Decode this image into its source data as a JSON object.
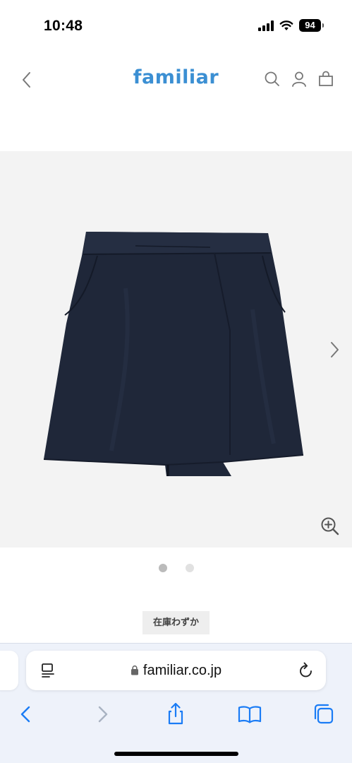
{
  "status_bar": {
    "time": "10:48",
    "battery": "94",
    "icons": [
      "signal-icon",
      "wifi-icon",
      "battery-icon"
    ]
  },
  "header": {
    "logo": "familiar",
    "logo_color": "#3b8fd3",
    "icons": [
      "back-chevron-icon",
      "search-icon",
      "account-icon",
      "bag-icon"
    ]
  },
  "product": {
    "image_label": "navy wrap skirt",
    "image_count": 2,
    "active_image": 1,
    "icons": [
      "next-arrow-icon",
      "zoom-in-icon"
    ]
  },
  "stock": {
    "label": "在庫わずか"
  },
  "browser": {
    "url": "familiar.co.jp",
    "accent_color": "#1a7cf5",
    "icons": [
      "reader-icon",
      "lock-icon",
      "reload-icon",
      "back-icon",
      "forward-icon",
      "share-icon",
      "bookmarks-icon",
      "tabs-icon"
    ]
  }
}
